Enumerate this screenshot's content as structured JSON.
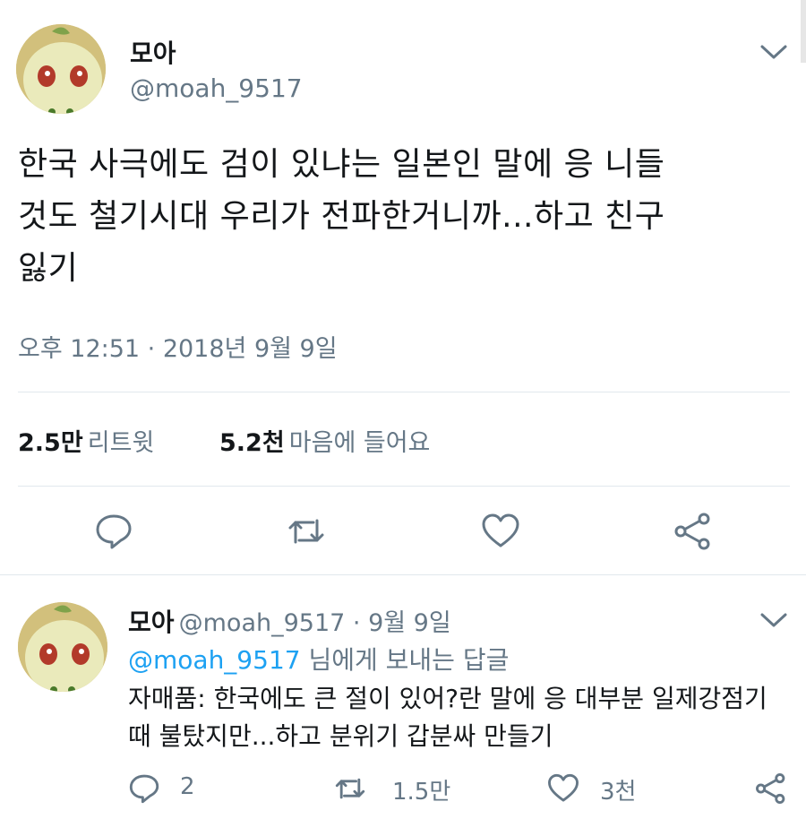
{
  "main_tweet": {
    "display_name": "모아",
    "handle": "@moah_9517",
    "text_lines": [
      "한국 사극에도 검이 있냐는 일본인 말에 응 니들",
      "것도 철기시대 우리가 전파한거니까...하고 친구",
      "잃기"
    ],
    "timestamp": "오후 12:51 · 2018년 9월 9일",
    "stats": {
      "retweets_count": "2.5만",
      "retweets_label": "리트윗",
      "likes_count": "5.2천",
      "likes_label": "마음에 들어요"
    }
  },
  "reply_tweet": {
    "display_name": "모아",
    "handle_date": "@moah_9517 · 9월 9일",
    "reply_to_handle": "@moah_9517",
    "reply_to_suffix": " 님에게 보내는 답글",
    "text_lines": [
      "자매품: 한국에도 큰 절이 있어?란 말에 응 대부분 일제강점기",
      "때 불탔지만...하고 분위기 갑분싸 만들기"
    ],
    "reply_count": "2",
    "retweet_count": "1.5만",
    "like_count": "3천"
  },
  "colors": {
    "text": "#14171a",
    "secondary": "#657786",
    "accent": "#1da1f2",
    "divider": "#e1e8ed"
  },
  "icons": [
    "chevron-down-icon",
    "reply-icon",
    "retweet-icon",
    "like-icon",
    "share-icon"
  ]
}
